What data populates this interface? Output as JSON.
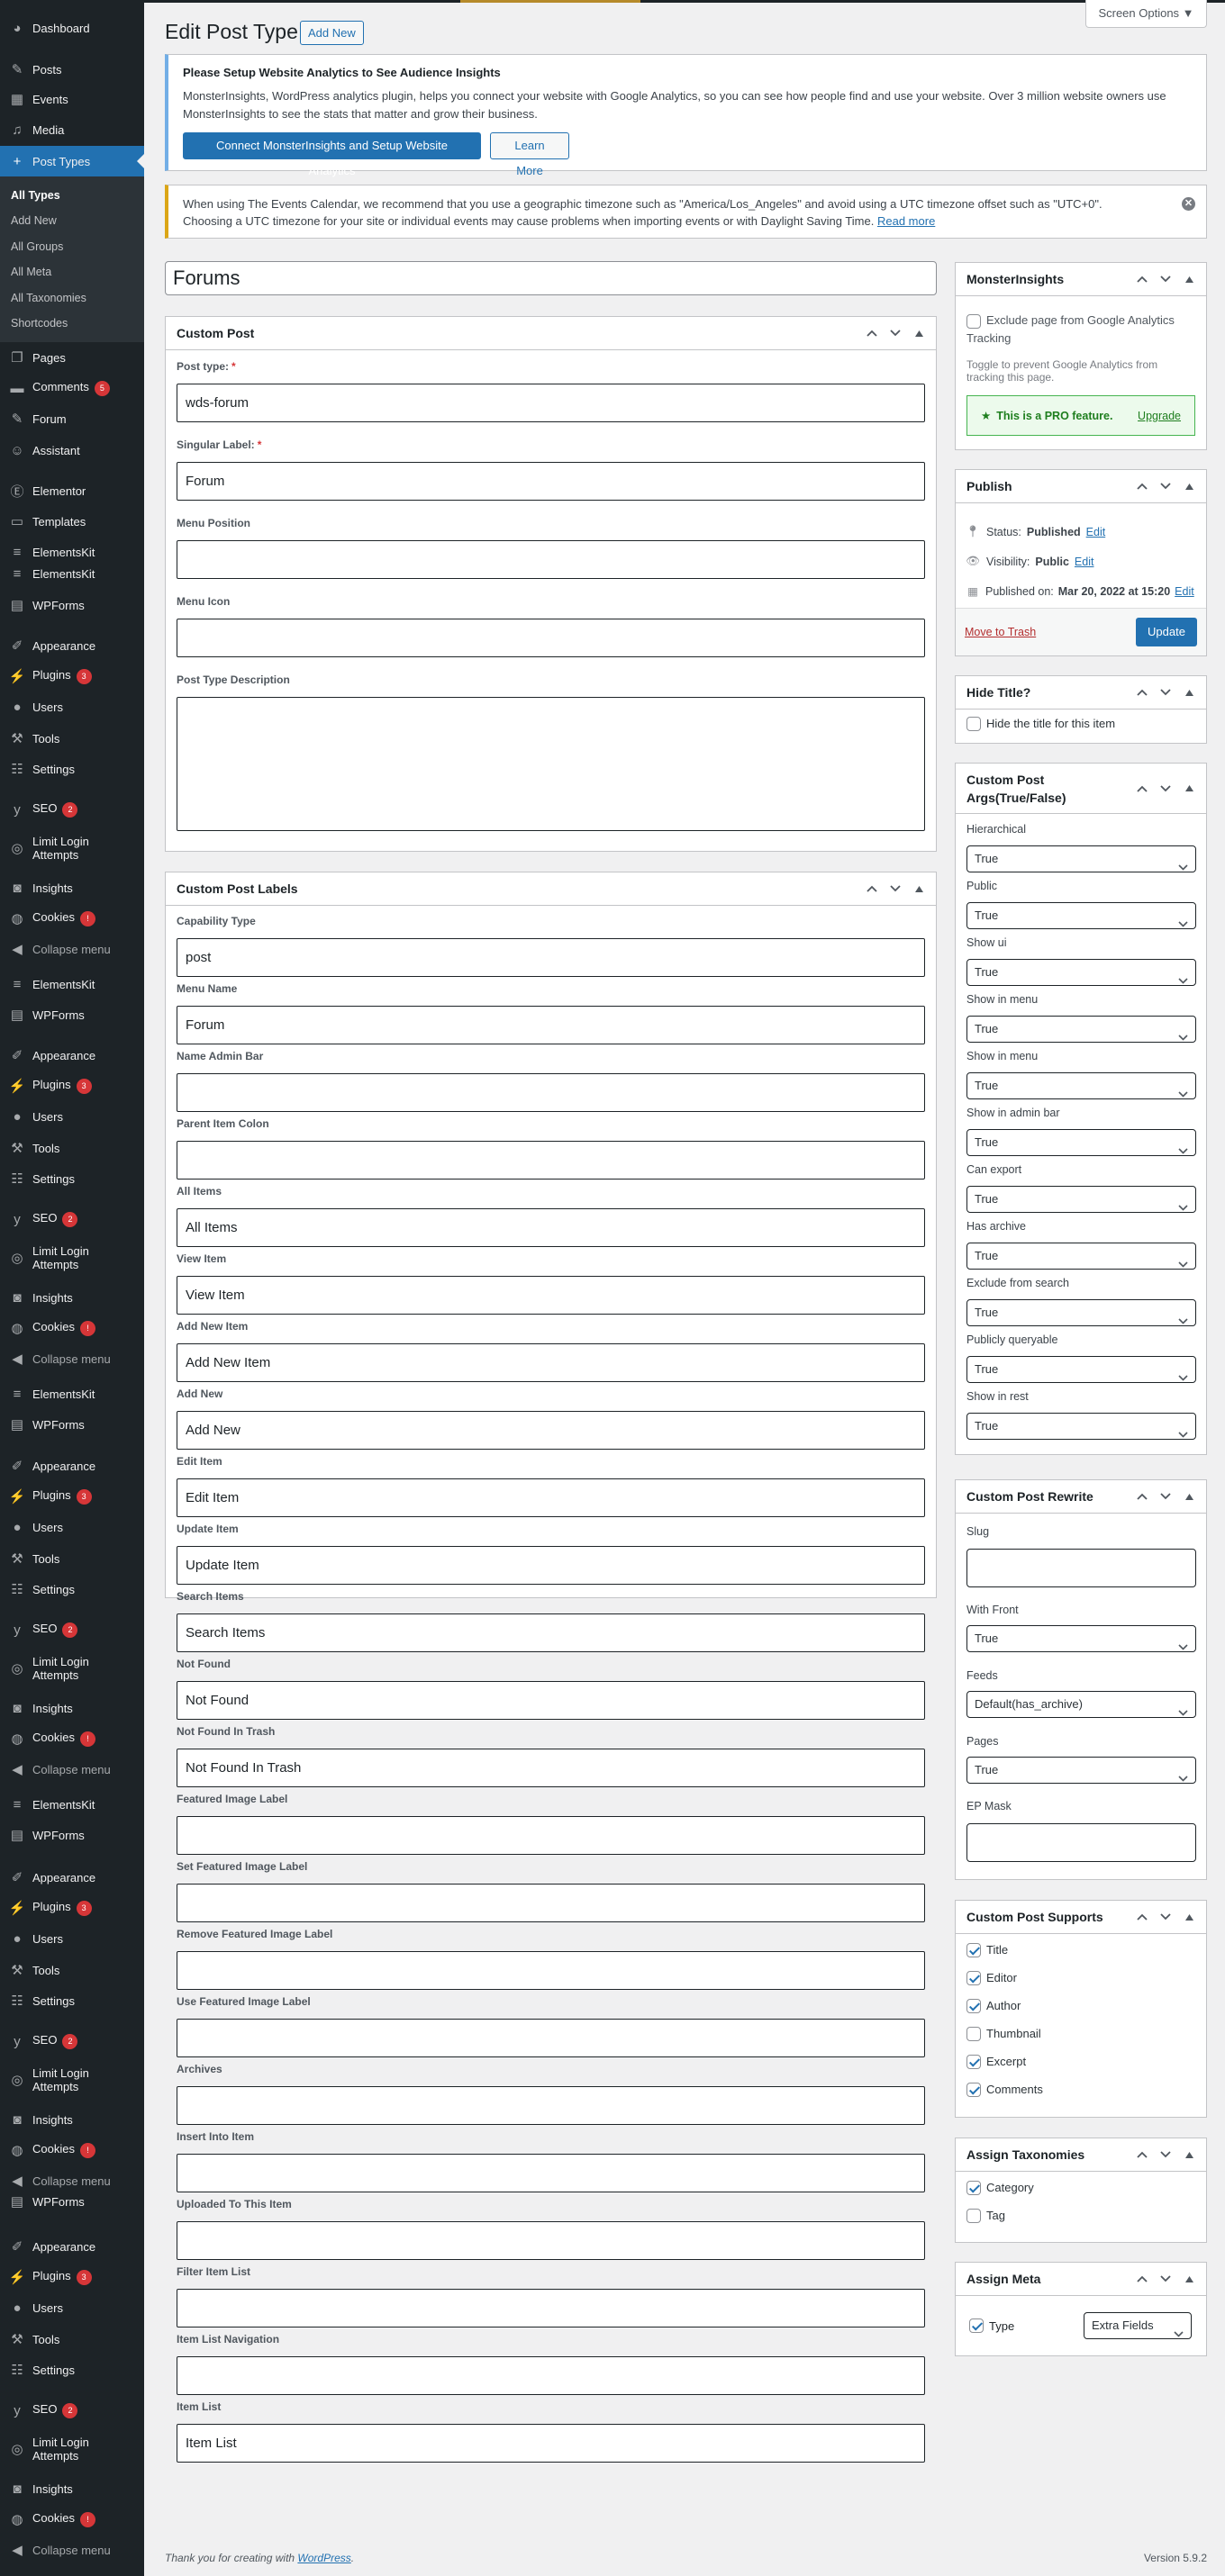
{
  "colors": {
    "sidebar_bg": "#1d2327",
    "accent": "#2271b1",
    "badge": "#d63638",
    "notice_info": "#72aee6",
    "notice_warning": "#dba617"
  },
  "sidebar": {
    "items": [
      {
        "label": "Dashboard",
        "icon": "dashboard-icon"
      },
      {
        "label": "Posts",
        "icon": "pin-icon"
      },
      {
        "label": "Events",
        "icon": "calendar-icon"
      },
      {
        "label": "Media",
        "icon": "media-icon"
      },
      {
        "label": "Post Types",
        "icon": "plus-icon",
        "active": true
      },
      {
        "label": "Pages",
        "icon": "pages-icon"
      },
      {
        "label": "Comments",
        "icon": "comment-icon",
        "badge": "5"
      },
      {
        "label": "Forum",
        "icon": "pin-icon"
      },
      {
        "label": "Assistant",
        "icon": "accessibility-icon"
      },
      {
        "label": "Elementor",
        "icon": "elementor-icon"
      },
      {
        "label": "Templates",
        "icon": "folder-icon"
      },
      {
        "label": "ElementsKit",
        "icon": "elementskit-icon"
      },
      {
        "label": "ElementsKit",
        "icon": "elementskit-icon"
      },
      {
        "label": "WPForms",
        "icon": "wpforms-icon"
      },
      {
        "label": "Appearance",
        "icon": "brush-icon"
      },
      {
        "label": "Plugins",
        "icon": "plugin-icon",
        "badge": "3"
      },
      {
        "label": "Users",
        "icon": "user-icon"
      },
      {
        "label": "Tools",
        "icon": "wrench-icon"
      },
      {
        "label": "Settings",
        "icon": "settings-icon"
      },
      {
        "label": "SEO",
        "icon": "yoast-icon",
        "badge": "2"
      },
      {
        "label": "Limit Login Attempts",
        "icon": "fingerprint-icon"
      },
      {
        "label": "Insights",
        "icon": "insights-icon"
      },
      {
        "label": "Cookies",
        "icon": "cookie-icon",
        "badge": "!"
      },
      {
        "label": "Collapse menu",
        "icon": "collapse-icon"
      },
      {
        "label": "ElementsKit",
        "icon": "elementskit-icon"
      },
      {
        "label": "WPForms",
        "icon": "wpforms-icon"
      },
      {
        "label": "Appearance",
        "icon": "brush-icon"
      },
      {
        "label": "Plugins",
        "icon": "plugin-icon",
        "badge": "3"
      },
      {
        "label": "Users",
        "icon": "user-icon"
      },
      {
        "label": "Tools",
        "icon": "wrench-icon"
      },
      {
        "label": "Settings",
        "icon": "settings-icon"
      },
      {
        "label": "SEO",
        "icon": "yoast-icon",
        "badge": "2"
      },
      {
        "label": "Limit Login Attempts",
        "icon": "fingerprint-icon"
      },
      {
        "label": "Insights",
        "icon": "insights-icon"
      },
      {
        "label": "Cookies",
        "icon": "cookie-icon",
        "badge": "!"
      },
      {
        "label": "Collapse menu",
        "icon": "collapse-icon"
      },
      {
        "label": "ElementsKit",
        "icon": "elementskit-icon"
      },
      {
        "label": "WPForms",
        "icon": "wpforms-icon"
      },
      {
        "label": "Appearance",
        "icon": "brush-icon"
      },
      {
        "label": "Plugins",
        "icon": "plugin-icon",
        "badge": "3"
      },
      {
        "label": "Users",
        "icon": "user-icon"
      },
      {
        "label": "Tools",
        "icon": "wrench-icon"
      },
      {
        "label": "Settings",
        "icon": "settings-icon"
      },
      {
        "label": "SEO",
        "icon": "yoast-icon",
        "badge": "2"
      },
      {
        "label": "Limit Login Attempts",
        "icon": "fingerprint-icon"
      },
      {
        "label": "Insights",
        "icon": "insights-icon"
      },
      {
        "label": "Cookies",
        "icon": "cookie-icon",
        "badge": "!"
      },
      {
        "label": "Collapse menu",
        "icon": "collapse-icon"
      },
      {
        "label": "ElementsKit",
        "icon": "elementskit-icon"
      },
      {
        "label": "WPForms",
        "icon": "wpforms-icon"
      },
      {
        "label": "Appearance",
        "icon": "brush-icon"
      },
      {
        "label": "Plugins",
        "icon": "plugin-icon",
        "badge": "3"
      },
      {
        "label": "Users",
        "icon": "user-icon"
      },
      {
        "label": "Tools",
        "icon": "wrench-icon"
      },
      {
        "label": "Settings",
        "icon": "settings-icon"
      },
      {
        "label": "SEO",
        "icon": "yoast-icon",
        "badge": "2"
      },
      {
        "label": "Limit Login Attempts",
        "icon": "fingerprint-icon"
      },
      {
        "label": "Insights",
        "icon": "insights-icon"
      },
      {
        "label": "Cookies",
        "icon": "cookie-icon",
        "badge": "!"
      },
      {
        "label": "Collapse menu",
        "icon": "collapse-icon"
      },
      {
        "label": "WPForms",
        "icon": "wpforms-icon"
      },
      {
        "label": "Appearance",
        "icon": "brush-icon"
      },
      {
        "label": "Plugins",
        "icon": "plugin-icon",
        "badge": "3"
      },
      {
        "label": "Users",
        "icon": "user-icon"
      },
      {
        "label": "Tools",
        "icon": "wrench-icon"
      },
      {
        "label": "Settings",
        "icon": "settings-icon"
      },
      {
        "label": "SEO",
        "icon": "yoast-icon",
        "badge": "2"
      },
      {
        "label": "Limit Login Attempts",
        "icon": "fingerprint-icon"
      },
      {
        "label": "Insights",
        "icon": "insights-icon"
      },
      {
        "label": "Cookies",
        "icon": "cookie-icon",
        "badge": "!"
      },
      {
        "label": "Collapse menu",
        "icon": "collapse-icon"
      }
    ],
    "submenu": [
      {
        "label": "All Types",
        "current": true
      },
      {
        "label": "Add New"
      },
      {
        "label": "All Groups"
      },
      {
        "label": "All Meta"
      },
      {
        "label": "All Taxonomies"
      },
      {
        "label": "Shortcodes"
      }
    ]
  },
  "header": {
    "title": "Edit Post Type",
    "add_new": "Add New",
    "screen_options": "Screen Options ▼"
  },
  "notices": {
    "analytics": {
      "title": "Please Setup Website Analytics to See Audience Insights",
      "line1": "MonsterInsights, WordPress analytics plugin, helps you connect your website with Google Analytics, so you can see how people find and use your website. Over 3 million website owners use",
      "line2": "MonsterInsights to see the stats that matter and grow their business.",
      "connect": "Connect MonsterInsights and Setup Website Analytics",
      "learn_more": "Learn More"
    },
    "timezone": {
      "line1": "When using The Events Calendar, we recommend that you use a geographic timezone such as \"America/Los_Angeles\" and avoid using a UTC timezone offset such as \"UTC+0\".",
      "line2": "Choosing a UTC timezone for your site or individual events may cause problems when importing events or with Daylight Saving Time.",
      "read_more": "Read more"
    }
  },
  "post_title": "Forums",
  "custom_post": {
    "title": "Custom Post",
    "required_mark": "*",
    "fields": [
      {
        "label": "Post type:",
        "required": true,
        "value": "wds-forum"
      },
      {
        "label": "Singular Label:",
        "required": true,
        "value": "Forum"
      },
      {
        "label": "Menu Position",
        "value": ""
      },
      {
        "label": "Menu Icon",
        "value": ""
      },
      {
        "label": "Post Type Description",
        "value": "",
        "multiline": true
      }
    ]
  },
  "custom_post_labels": {
    "title": "Custom Post Labels",
    "fields": [
      {
        "label": "Capability Type",
        "value": "post"
      },
      {
        "label": "Menu Name",
        "value": "Forum"
      },
      {
        "label": "Name Admin Bar",
        "value": ""
      },
      {
        "label": "Parent Item Colon",
        "value": ""
      },
      {
        "label": "All Items",
        "value": "All Items"
      },
      {
        "label": "View Item",
        "value": "View Item"
      },
      {
        "label": "Add New Item",
        "value": "Add New Item"
      },
      {
        "label": "Add New",
        "value": "Add New"
      },
      {
        "label": "Edit Item",
        "value": "Edit Item"
      },
      {
        "label": "Update Item",
        "value": "Update Item"
      },
      {
        "label": "Search Items",
        "value": "Search Items"
      },
      {
        "label": "Not Found",
        "value": "Not Found"
      },
      {
        "label": "Not Found In Trash",
        "value": "Not Found In Trash"
      },
      {
        "label": "Featured Image Label",
        "value": ""
      },
      {
        "label": "Set Featured Image Label",
        "value": ""
      },
      {
        "label": "Remove Featured Image Label",
        "value": ""
      },
      {
        "label": "Use Featured Image Label",
        "value": ""
      },
      {
        "label": "Archives",
        "value": ""
      },
      {
        "label": "Insert Into Item",
        "value": ""
      },
      {
        "label": "Uploaded To This Item",
        "value": ""
      },
      {
        "label": "Filter Item List",
        "value": ""
      },
      {
        "label": "Item List Navigation",
        "value": ""
      },
      {
        "label": "Item List",
        "value": "Item List"
      }
    ]
  },
  "monsterinsights": {
    "title": "MonsterInsights",
    "exclude_label": "Exclude page from Google Analytics Tracking",
    "exclude_checked": false,
    "help": "Toggle to prevent Google Analytics from tracking this page.",
    "pro_text": "This is a PRO feature.",
    "upgrade": "Upgrade"
  },
  "publish": {
    "title": "Publish",
    "status_label": "Status:",
    "status": "Published",
    "visibility_label": "Visibility:",
    "visibility": "Public",
    "published_label": "Published on:",
    "published": "Mar 20, 2022 at 15:20",
    "edit": "Edit",
    "trash": "Move to Trash",
    "update": "Update"
  },
  "hide_title": {
    "title": "Hide Title?",
    "label": "Hide the title for this item",
    "checked": false
  },
  "args": {
    "title": "Custom Post Args(True/False)",
    "fields": [
      {
        "label": "Hierarchical",
        "value": "True"
      },
      {
        "label": "Public",
        "value": "True"
      },
      {
        "label": "Show ui",
        "value": "True"
      },
      {
        "label": "Show in menu",
        "value": "True"
      },
      {
        "label": "Show in menu",
        "value": "True"
      },
      {
        "label": "Show in admin bar",
        "value": "True"
      },
      {
        "label": "Can export",
        "value": "True"
      },
      {
        "label": "Has archive",
        "value": "True"
      },
      {
        "label": "Exclude from search",
        "value": "True"
      },
      {
        "label": "Publicly queryable",
        "value": "True"
      },
      {
        "label": "Show in rest",
        "value": "True"
      }
    ]
  },
  "rewrite": {
    "title": "Custom Post Rewrite",
    "slug_label": "Slug",
    "slug": "",
    "with_front_label": "With Front",
    "with_front": "True",
    "feeds_label": "Feeds",
    "feeds": "Default(has_archive)",
    "pages_label": "Pages",
    "pages": "True",
    "ep_mask_label": "EP Mask",
    "ep_mask": ""
  },
  "supports": {
    "title": "Custom Post Supports",
    "items": [
      {
        "label": "Title",
        "checked": true
      },
      {
        "label": "Editor",
        "checked": true
      },
      {
        "label": "Author",
        "checked": true
      },
      {
        "label": "Thumbnail",
        "checked": false
      },
      {
        "label": "Excerpt",
        "checked": true
      },
      {
        "label": "Comments",
        "checked": true
      }
    ]
  },
  "taxonomies": {
    "title": "Assign Taxonomies",
    "items": [
      {
        "label": "Category",
        "checked": true
      },
      {
        "label": "Tag",
        "checked": false
      }
    ]
  },
  "meta": {
    "title": "Assign Meta",
    "type_label": "Type",
    "type_checked": true,
    "select": "Extra Fields"
  },
  "footer": {
    "thanks": "Thank you for creating with ",
    "wordpress": "WordPress",
    "period": ".",
    "version": "Version 5.9.2"
  }
}
